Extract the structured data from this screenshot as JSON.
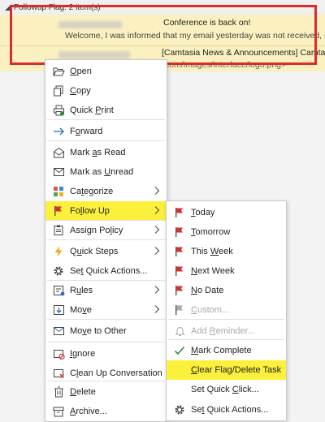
{
  "group_header": {
    "label": "Followup Flag: 2 item(s)"
  },
  "rows": [
    {
      "subject": "Conference is back on!",
      "preview": "Welcome,  I was informed that my email yesterday was not received, so if you rec"
    },
    {
      "subject": "[Camtasia News & Announcements] Camtasia Windo",
      "preview": "com/images/interface/logo.png>"
    }
  ],
  "context_menu": {
    "items": [
      {
        "id": "open",
        "label": "Open",
        "icon": "folder-open-icon",
        "mnemonic": 0
      },
      {
        "id": "copy",
        "label": "Copy",
        "icon": "copy-icon",
        "mnemonic": 0
      },
      {
        "id": "quick-print",
        "label": "Quick Print",
        "icon": "print-icon",
        "mnemonic": 6
      },
      {
        "id": "forward",
        "label": "Forward",
        "icon": "forward-arrow-icon",
        "mnemonic": 1
      },
      {
        "id": "mark-read",
        "label": "Mark as Read",
        "icon": "envelope-open-icon",
        "mnemonic": 5
      },
      {
        "id": "mark-unread",
        "label": "Mark as Unread",
        "icon": "envelope-icon",
        "mnemonic": 8
      },
      {
        "id": "categorize",
        "label": "Categorize",
        "icon": "category-grid-icon",
        "mnemonic": 2,
        "submenu": true
      },
      {
        "id": "follow-up",
        "label": "Follow Up",
        "icon": "red-flag-icon",
        "mnemonic": 2,
        "submenu": true,
        "highlight": true
      },
      {
        "id": "assign-policy",
        "label": "Assign Policy",
        "icon": "policy-icon",
        "mnemonic": 9,
        "submenu": true
      },
      {
        "id": "quick-steps",
        "label": "Quick Steps",
        "icon": "lightning-icon",
        "mnemonic": 1,
        "submenu": true
      },
      {
        "id": "set-quick-actions",
        "label": "Set Quick Actions...",
        "icon": "gear-icon",
        "mnemonic": 2
      },
      {
        "id": "rules",
        "label": "Rules",
        "icon": "rules-icon",
        "mnemonic": 1,
        "submenu": true
      },
      {
        "id": "move",
        "label": "Move",
        "icon": "move-icon",
        "mnemonic": 2,
        "submenu": true
      },
      {
        "id": "move-other",
        "label": "Move to Other",
        "icon": "move-to-other-icon",
        "mnemonic": 2
      },
      {
        "id": "ignore",
        "label": "Ignore",
        "icon": "ignore-icon",
        "mnemonic": 0
      },
      {
        "id": "clean-up",
        "label": "Clean Up Conversation",
        "icon": "clean-up-icon",
        "mnemonic": 1
      },
      {
        "id": "delete",
        "label": "Delete",
        "icon": "trash-icon",
        "mnemonic": 0
      },
      {
        "id": "archive",
        "label": "Archive...",
        "icon": "archive-icon",
        "mnemonic": 0
      }
    ]
  },
  "followup_submenu": {
    "items": [
      {
        "id": "today",
        "label": "Today",
        "icon": "red-flag-icon",
        "mnemonic": 0
      },
      {
        "id": "tomorrow",
        "label": "Tomorrow",
        "icon": "red-flag-icon",
        "mnemonic": 0
      },
      {
        "id": "this-week",
        "label": "This Week",
        "icon": "red-flag-icon",
        "mnemonic": 5
      },
      {
        "id": "next-week",
        "label": "Next Week",
        "icon": "red-flag-icon",
        "mnemonic": 0
      },
      {
        "id": "no-date",
        "label": "No Date",
        "icon": "red-flag-icon",
        "mnemonic": 0
      },
      {
        "id": "custom",
        "label": "Custom...",
        "icon": "gray-flag-icon",
        "mnemonic": 0,
        "disabled": true
      },
      {
        "id": "add-reminder",
        "label": "Add Reminder...",
        "icon": "bell-icon",
        "mnemonic": 4,
        "disabled": true
      },
      {
        "id": "mark-complete",
        "label": "Mark Complete",
        "icon": "checkmark-icon",
        "mnemonic": 0
      },
      {
        "id": "clear-flag",
        "label": "Clear Flag/Delete Task",
        "icon": "",
        "mnemonic": 0,
        "highlight": true
      },
      {
        "id": "set-quick-click",
        "label": "Set Quick Click...",
        "icon": "",
        "mnemonic": 10
      },
      {
        "id": "set-quick-actions-sub",
        "label": "Set Quick Actions...",
        "icon": "gear-icon",
        "mnemonic": 2
      }
    ]
  },
  "colors": {
    "flag_red": "#d9302c",
    "highlight": "#fbf03b",
    "selection_row": "#fbf1c0",
    "annotation_red": "#dd2b2b",
    "icon_blue": "#2b6fb5",
    "check_green": "#2e8b3a"
  }
}
